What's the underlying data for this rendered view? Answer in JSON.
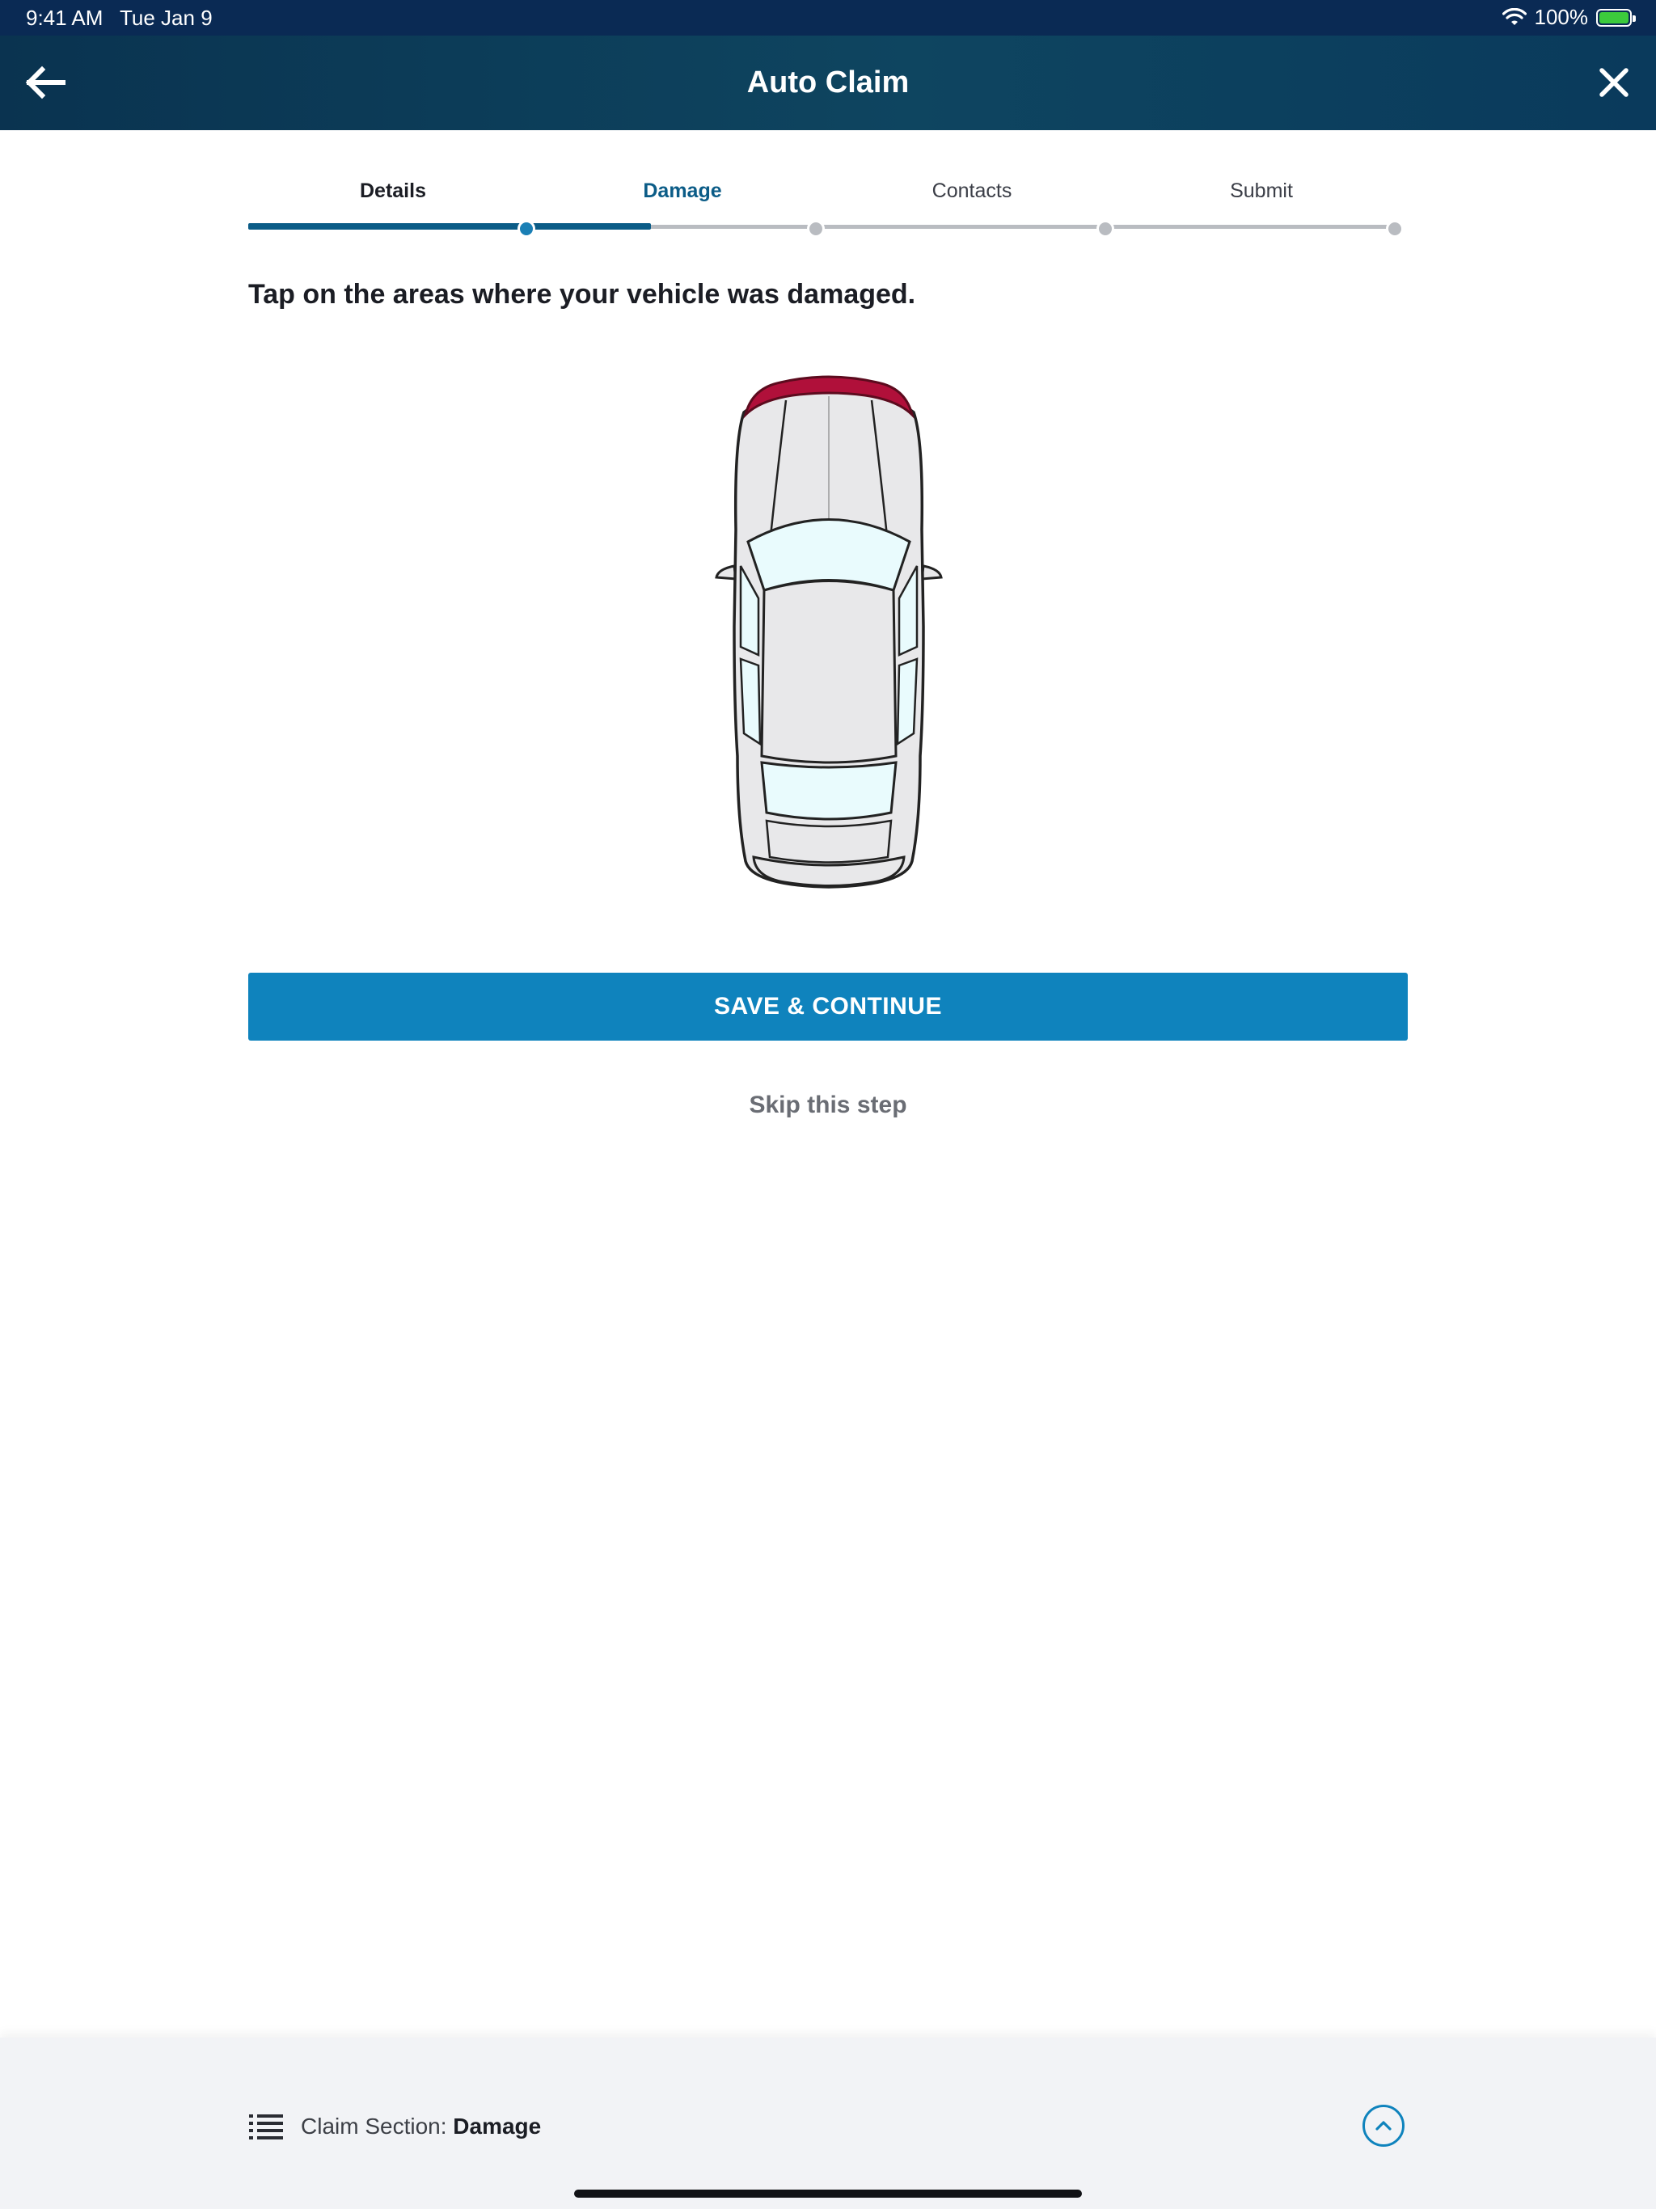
{
  "status_bar": {
    "time": "9:41 AM",
    "date": "Tue Jan 9",
    "battery": "100%",
    "battery_level": 1.0
  },
  "header": {
    "title": "Auto Claim",
    "back_icon": "arrow-left-icon",
    "close_icon": "close-icon"
  },
  "stepper": {
    "steps": [
      {
        "label": "Details",
        "state": "done"
      },
      {
        "label": "Damage",
        "state": "active"
      },
      {
        "label": "Contacts",
        "state": "upcoming"
      },
      {
        "label": "Submit",
        "state": "upcoming"
      }
    ],
    "progress": 0.35
  },
  "main": {
    "instruction": "Tap on the areas where your vehicle was damaged.",
    "car_diagram": {
      "selected_areas": [
        "front-bumper"
      ],
      "selected_color": "#b0103a",
      "glass_color": "#e9fbfd",
      "body_color": "#e8e8ea"
    },
    "save_label": "SAVE & CONTINUE",
    "skip_label": "Skip this step"
  },
  "bottom_bar": {
    "section_prefix": "Claim Section:",
    "section_value": "Damage",
    "list_icon": "list-icon",
    "expand_icon": "chevron-up-icon"
  },
  "colors": {
    "header_bg": "#0e4560",
    "accent": "#0f83bd",
    "active_step": "#0b5c87"
  }
}
